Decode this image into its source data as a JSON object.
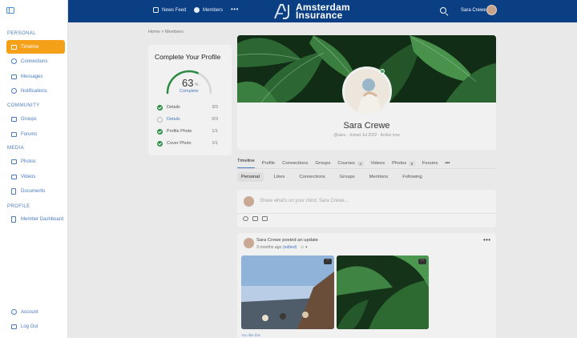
{
  "sidebar": {
    "sections": {
      "personal": "PERSONAL",
      "community": "COMMUNITY",
      "media": "MEDIA",
      "profile": "PROFILE"
    },
    "items": {
      "timeline": "Timeline",
      "connections": "Connections",
      "messages": "Messages",
      "notifications": "Notifications",
      "groups": "Groups",
      "forums": "Forums",
      "photos": "Photos",
      "videos": "Videos",
      "documents": "Documents",
      "member_dashboard": "Member Dashboard",
      "account": "Account",
      "log_out": "Log Out"
    },
    "active_color": "#f4a018"
  },
  "topbar": {
    "news_feed": "News Feed",
    "members": "Members",
    "more": "•••",
    "logo_line1": "Amsterdam",
    "logo_line2": "Insurance",
    "user_name": "Sara Crewe",
    "bg_color": "#0b3f84"
  },
  "breadcrumb": "Home > Members",
  "completion": {
    "title": "Complete Your Profile",
    "percent_value": "63",
    "percent_sign": "%",
    "percent_fraction": 0.63,
    "complete_label": "Complete",
    "items": [
      {
        "label": "Details",
        "count": "3/3",
        "done": true
      },
      {
        "label": "Details",
        "count": "0/3",
        "done": false
      },
      {
        "label": "Profile Photo",
        "count": "1/1",
        "done": true
      },
      {
        "label": "Cover Photo",
        "count": "1/1",
        "done": true
      }
    ]
  },
  "profile": {
    "name": "Sara Crewe",
    "meta": "@sara · Joined Jul 2022 · Active now"
  },
  "tabs": {
    "timeline": "Timeline",
    "profile": "Profile",
    "connections": "Connections",
    "groups": "Groups",
    "courses": "Courses",
    "courses_badge": "4",
    "videos": "Videos",
    "photos": "Photos",
    "photos_badge": "5",
    "forums": "Forums",
    "more": "•••"
  },
  "subtabs": {
    "personal": "Personal",
    "likes": "Likes",
    "connections": "Connections",
    "groups": "Groups",
    "mentions": "Mentions",
    "following": "Following"
  },
  "composer": {
    "placeholder": "Share what's on your mind, Sara Crewe..."
  },
  "post": {
    "author_line": "Sara Crewe posted an update",
    "time": "3 months ago",
    "edited": "(edited)",
    "privacy": "▾",
    "more": "•••",
    "likes_text": "You like this"
  }
}
